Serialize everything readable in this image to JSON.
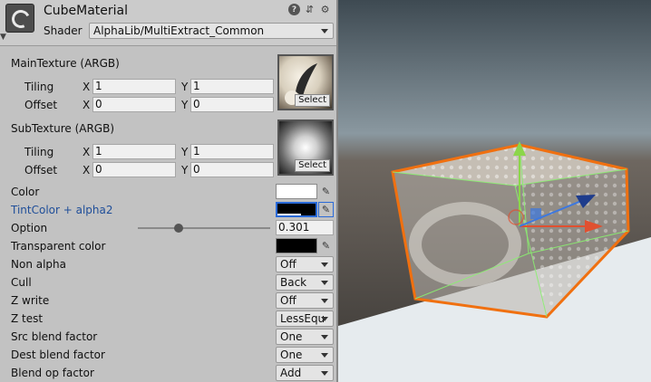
{
  "header": {
    "title": "CubeMaterial",
    "icons": [
      "help-icon",
      "preset-icon",
      "gear-icon"
    ],
    "shader_label": "Shader",
    "shader_value": "AlphaLib/MultiExtract_Common"
  },
  "main_texture": {
    "label": "MainTexture (ARGB)",
    "tiling_label": "Tiling",
    "offset_label": "Offset",
    "x_label": "X",
    "y_label": "Y",
    "tiling_x": "1",
    "tiling_y": "1",
    "offset_x": "0",
    "offset_y": "0",
    "select_label": "Select"
  },
  "sub_texture": {
    "label": "SubTexture (ARGB)",
    "tiling_label": "Tiling",
    "offset_label": "Offset",
    "x_label": "X",
    "y_label": "Y",
    "tiling_x": "1",
    "tiling_y": "1",
    "offset_x": "0",
    "offset_y": "0",
    "select_label": "Select"
  },
  "properties": {
    "color_label": "Color",
    "color_value": "#ffffff",
    "tint_label": "TintColor + alpha2",
    "tint_label_color": "#1f4e99",
    "tint_value": "#000000",
    "option_label": "Option",
    "option_value": "0.301",
    "option_fraction": 0.31,
    "transparent_label": "Transparent color",
    "transparent_value": "#000000",
    "non_alpha_label": "Non alpha",
    "non_alpha_value": "Off",
    "cull_label": "Cull",
    "cull_value": "Back",
    "zwrite_label": "Z write",
    "zwrite_value": "Off",
    "ztest_label": "Z test",
    "ztest_value": "LessEqu",
    "src_label": "Src blend factor",
    "src_value": "One",
    "dest_label": "Dest blend factor",
    "dest_value": "One",
    "blendop_label": "Blend op factor",
    "blendop_value": "Add"
  }
}
